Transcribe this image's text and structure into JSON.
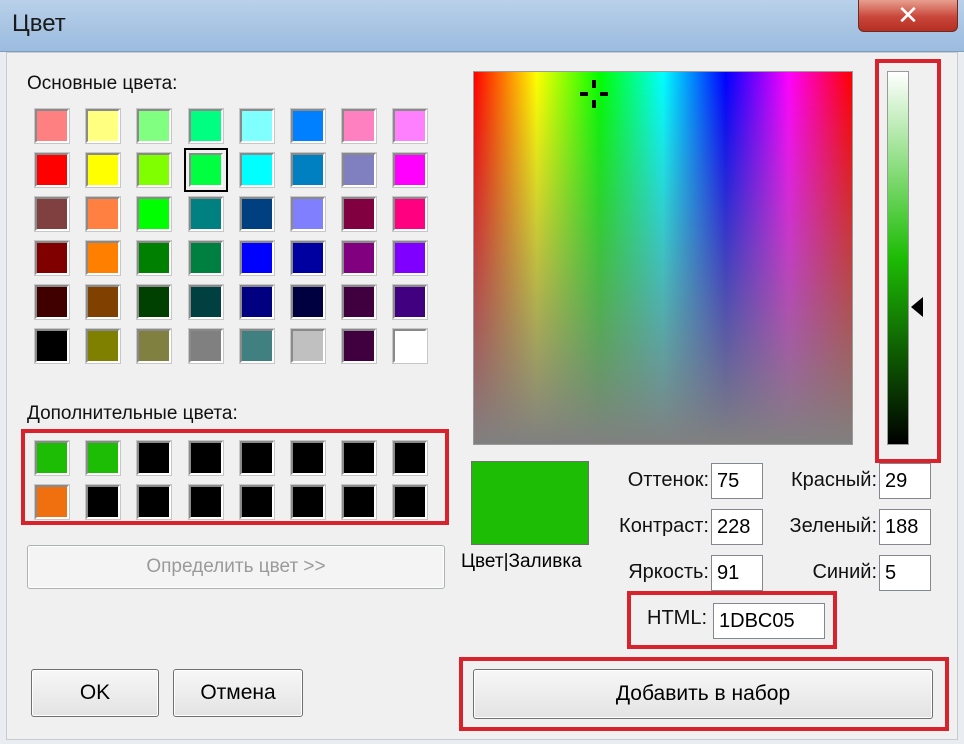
{
  "window": {
    "title": "Цвет",
    "close_glyph": "✕"
  },
  "basic_colors": {
    "label": "Основные цвета:",
    "swatches": [
      "#ff8080",
      "#ffff80",
      "#80ff80",
      "#00ff80",
      "#80ffff",
      "#0080ff",
      "#ff80c0",
      "#ff80ff",
      "#ff0000",
      "#ffff00",
      "#80ff00",
      "#00ff40",
      "#00ffff",
      "#0080c0",
      "#8080c0",
      "#ff00ff",
      "#804040",
      "#ff8040",
      "#00ff00",
      "#008080",
      "#004080",
      "#8080ff",
      "#800040",
      "#ff0080",
      "#800000",
      "#ff8000",
      "#008000",
      "#008040",
      "#0000ff",
      "#0000a0",
      "#800080",
      "#8000ff",
      "#400000",
      "#804000",
      "#004000",
      "#004040",
      "#000080",
      "#000040",
      "#400040",
      "#400080",
      "#000000",
      "#808000",
      "#808040",
      "#808080",
      "#408080",
      "#c0c0c0",
      "#400040",
      "#ffffff"
    ],
    "selected_index": 11
  },
  "custom_colors": {
    "label": "Дополнительные цвета:",
    "swatches": [
      "#1dbc05",
      "#1dbc05",
      "#000000",
      "#000000",
      "#000000",
      "#000000",
      "#000000",
      "#000000",
      "#f07010",
      "#000000",
      "#000000",
      "#000000",
      "#000000",
      "#000000",
      "#000000",
      "#000000"
    ]
  },
  "buttons": {
    "define_color": "Определить цвет >>",
    "ok": "OK",
    "cancel": "Отмена",
    "add_to_custom": "Добавить в набор"
  },
  "preview": {
    "caption": "Цвет|Заливка",
    "color": "#1dbc05"
  },
  "fields": {
    "hue_label": "Оттенок:",
    "hue": "75",
    "sat_label": "Контраст:",
    "sat": "228",
    "lum_label": "Яркость:",
    "lum": "91",
    "red_label": "Красный:",
    "red": "29",
    "green_label": "Зеленый:",
    "green": "188",
    "blue_label": "Синий:",
    "blue": "5",
    "html_label": "HTML:",
    "html": "1DBC05"
  },
  "highlight_color": "#d9232c"
}
